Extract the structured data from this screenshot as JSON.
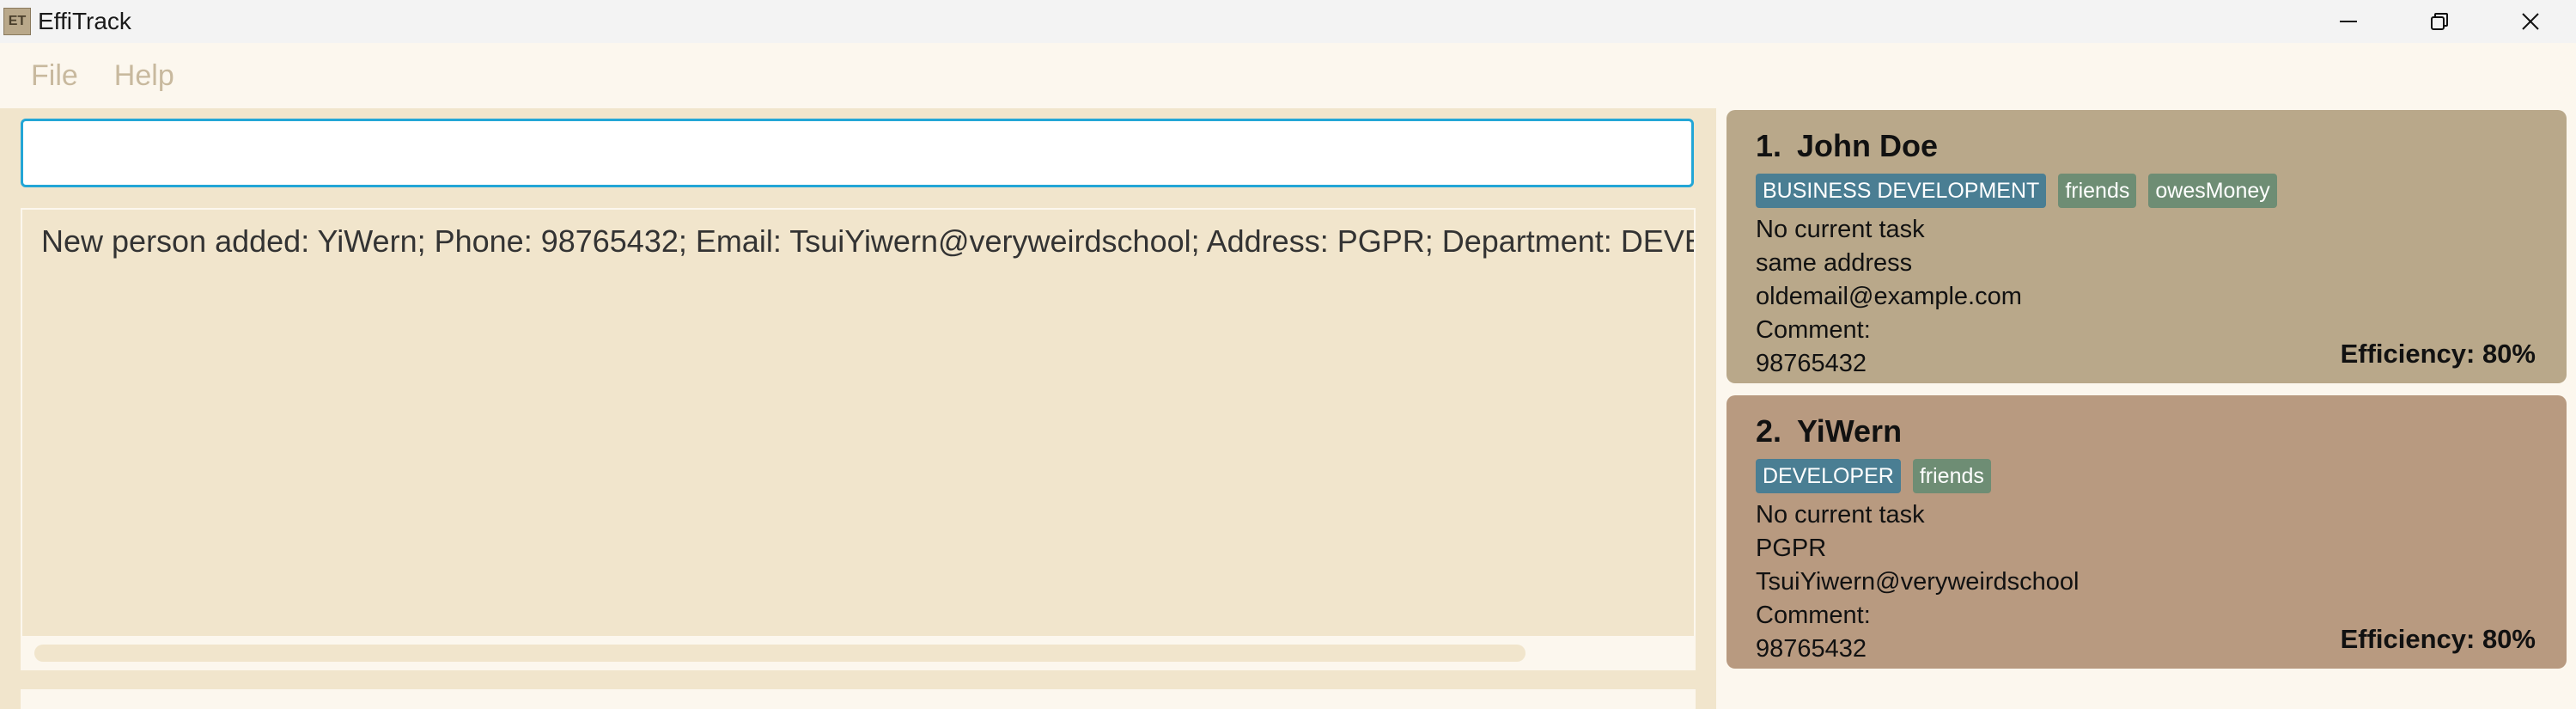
{
  "window": {
    "title": "EffiTrack",
    "icon_text": "ET",
    "controls": [
      "minimize-icon",
      "restore-icon",
      "close-icon"
    ]
  },
  "menu": {
    "items": [
      "File",
      "Help"
    ]
  },
  "command": {
    "value": "",
    "placeholder": ""
  },
  "result": {
    "text": "New person added: YiWern; Phone: 98765432; Email: TsuiYiwern@veryweirdschool; Address: PGPR; Department: DEVELOPER; T"
  },
  "persons": [
    {
      "index": "1.",
      "name": "John Doe",
      "department": "BUSINESS DEVELOPMENT",
      "tags": [
        "friends",
        "owesMoney"
      ],
      "task": "No current task",
      "address": "same address",
      "email": "oldemail@example.com",
      "comment": "Comment:",
      "phone": "98765432",
      "efficiency": "Efficiency: 80%"
    },
    {
      "index": "2.",
      "name": "YiWern",
      "department": "DEVELOPER",
      "tags": [
        "friends"
      ],
      "task": "No current task",
      "address": "PGPR",
      "email": "TsuiYiwern@veryweirdschool",
      "comment": "Comment:",
      "phone": "98765432",
      "efficiency": "Efficiency: 80%"
    }
  ],
  "colors": {
    "accent_border": "#23a6d6",
    "department_tag": "#4a7e93",
    "tag": "#6e8d74",
    "card1_bg": "#b9a88a",
    "card2_bg": "#b89a80",
    "panel_bg": "#f1e5cc"
  }
}
